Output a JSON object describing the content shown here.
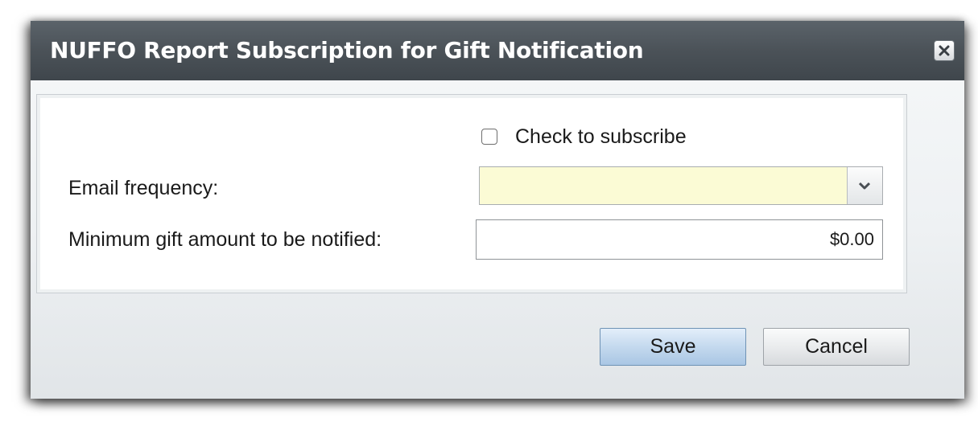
{
  "dialog": {
    "title": "NUFFO Report Subscription for Gift Notification",
    "close_icon": "close-icon"
  },
  "form": {
    "subscribe": {
      "label": "Check to subscribe",
      "checked": false
    },
    "email_frequency": {
      "label": "Email frequency:",
      "value": "",
      "dropdown_icon": "chevron-down-icon"
    },
    "minimum_gift": {
      "label": "Minimum gift amount to be notified:",
      "value": "$0.00"
    }
  },
  "buttons": {
    "save_label": "Save",
    "cancel_label": "Cancel"
  },
  "colors": {
    "titlebar": "#4b5258",
    "required_field": "#fbfbd5",
    "primary_button": "#c4d9ee"
  }
}
